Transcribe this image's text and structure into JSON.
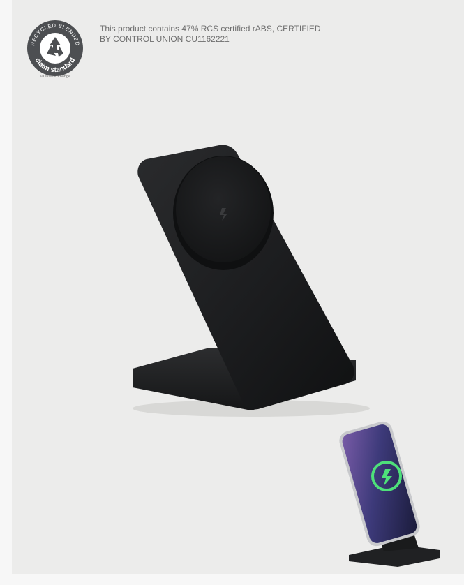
{
  "badge": {
    "top_text": "RECYCLED BLENDED",
    "bottom_text": "claim standard",
    "footer": "©TextileExchange"
  },
  "certification": {
    "line1": "This product contains 47% RCS certified rABS, CERTIFIED",
    "line2": "BY CONTROL UNION CU1162221"
  },
  "product": {
    "image_icon": "wireless-charging-stand-icon",
    "inset_icon": "phone-on-charger-icon"
  },
  "colors": {
    "background": "#ececeb",
    "stand": "#1f2022",
    "badge": "#4d4f52"
  }
}
